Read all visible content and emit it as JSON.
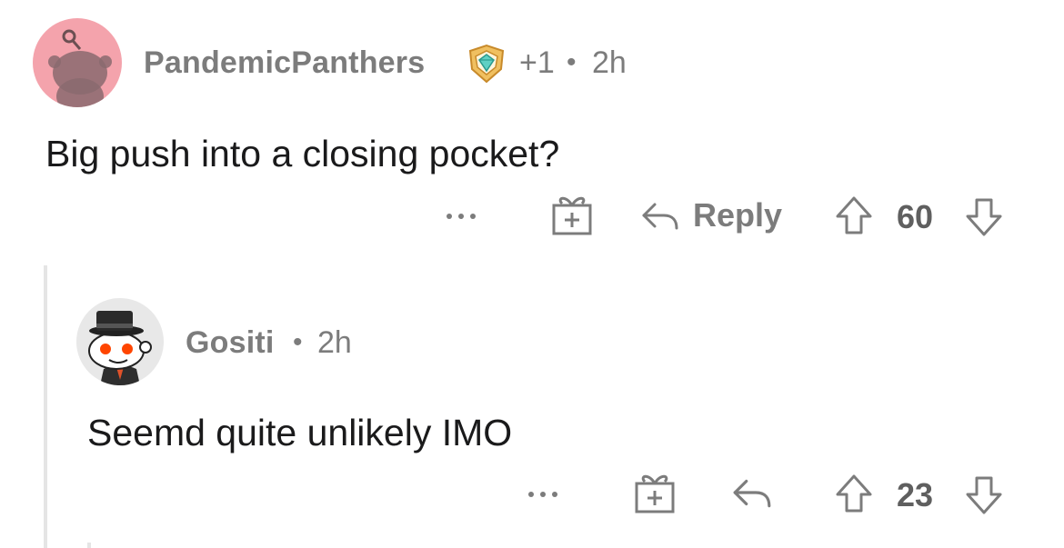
{
  "comments": [
    {
      "username": "PandemicPanthers",
      "avatar_icon": "snoo-avatar-pink",
      "award_icon": "diamond-award-icon",
      "karma_badge": "+1",
      "time": "2h",
      "body": "Big push into a closing pocket?",
      "more_icon": "...",
      "reply_label": "Reply",
      "score": "60"
    },
    {
      "username": "Gositi",
      "avatar_icon": "snoo-avatar-top-hat",
      "time": "2h",
      "body": "Seemd quite unlikely IMO",
      "more_icon": "...",
      "score": "23"
    }
  ],
  "separator": "•",
  "colors": {
    "avatar_pink": "#f4a3ac",
    "avatar_gray": "#e8e8e8",
    "text_muted": "#7c7c7c",
    "text_main": "#1a1a1b",
    "thread_line": "#e5e5e5",
    "snoo_orange": "#ff4500"
  }
}
